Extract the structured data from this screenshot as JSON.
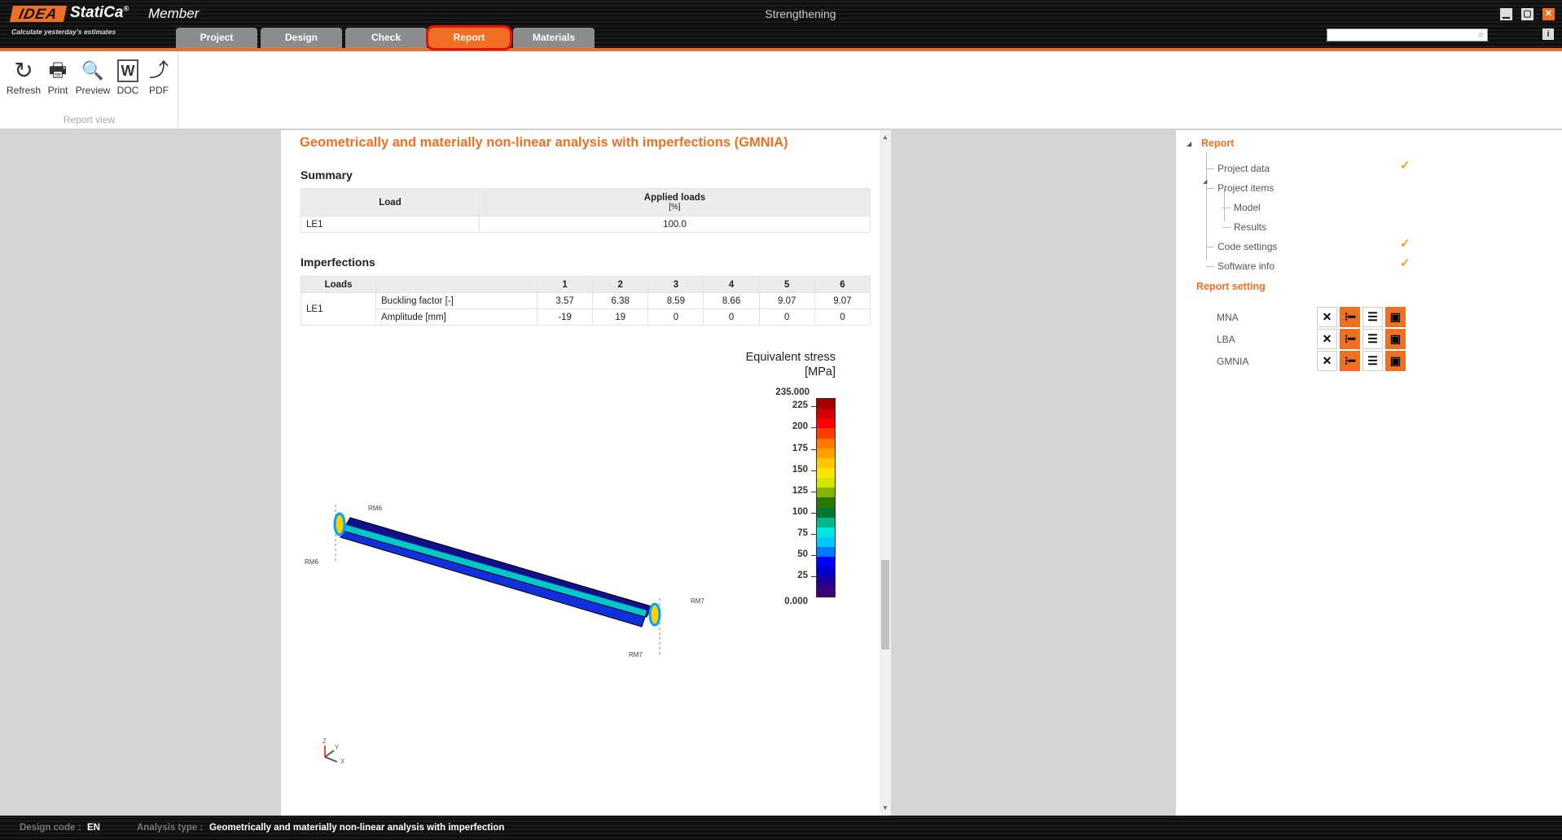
{
  "app": {
    "logo_brand": "IDEA",
    "logo_name": "StatiCa",
    "logo_reg": "®",
    "product": "Member",
    "tagline": "Calculate yesterday's estimates",
    "title": "Strengthening"
  },
  "tabs": [
    {
      "label": "Project"
    },
    {
      "label": "Design"
    },
    {
      "label": "Check"
    },
    {
      "label": "Report",
      "active": true
    },
    {
      "label": "Materials"
    }
  ],
  "search": {
    "placeholder": "",
    "icon": "search-icon"
  },
  "window_controls": {
    "minimize": "▁",
    "maximize": "▢",
    "close": "✕",
    "info": "i"
  },
  "ribbon": {
    "group_label": "Report view",
    "buttons": [
      {
        "label": "Refresh",
        "icon": "refresh-icon",
        "glyph": "↻"
      },
      {
        "label": "Print",
        "icon": "printer-icon",
        "glyph": "🖶"
      },
      {
        "label": "Preview",
        "icon": "preview-icon",
        "glyph": "🔍"
      },
      {
        "label": "DOC",
        "icon": "word-doc-icon",
        "glyph": "W"
      },
      {
        "label": "PDF",
        "icon": "pdf-icon",
        "glyph": "⤴"
      }
    ]
  },
  "report": {
    "title": "Geometrically and materially non-linear analysis with imperfections (GMNIA)",
    "summary": {
      "heading": "Summary",
      "headers": [
        "Load",
        "Applied loads",
        "[%]"
      ],
      "rows": [
        [
          "LE1",
          "100.0"
        ]
      ]
    },
    "imperfections": {
      "heading": "Imperfections",
      "headers": [
        "Loads",
        "",
        "1",
        "2",
        "3",
        "4",
        "5",
        "6"
      ],
      "load": "LE1",
      "rows": [
        {
          "label": "Buckling factor [-]",
          "values": [
            "3.57",
            "6.38",
            "8.59",
            "8.66",
            "9.07",
            "9.07"
          ]
        },
        {
          "label": "Amplitude [mm]",
          "values": [
            "-19",
            "19",
            "0",
            "0",
            "0",
            "0"
          ]
        }
      ]
    },
    "figure": {
      "legend_title": "Equivalent stress",
      "legend_unit": "[MPa]",
      "max_label": "235.000",
      "min_label": "0.000",
      "ticks": [
        "225",
        "200",
        "175",
        "150",
        "125",
        "100",
        "75",
        "50",
        "25"
      ],
      "tick_values": [
        225,
        200,
        175,
        150,
        125,
        100,
        75,
        50,
        25
      ],
      "range": [
        0,
        235
      ],
      "colors": [
        "#a00000",
        "#d00000",
        "#ff0000",
        "#ff3c00",
        "#ff7800",
        "#ffa000",
        "#ffc800",
        "#ffe600",
        "#d2e600",
        "#82b400",
        "#287800",
        "#007832",
        "#00b48c",
        "#00e6dc",
        "#00c8ff",
        "#0078ff",
        "#0000ff",
        "#0000c8",
        "#1e0096",
        "#3c0078"
      ],
      "labels": {
        "rm6_top": "RM6",
        "rm6_left": "RM6",
        "rm7_right": "RM7",
        "rm7_bottom": "RM7"
      },
      "axes": {
        "z": "Z",
        "y": "Y",
        "x": "X"
      }
    }
  },
  "right_panel": {
    "tree_root": "Report",
    "items": [
      {
        "label": "Project data",
        "checked": true
      },
      {
        "label": "Project items",
        "checked": false
      },
      {
        "label": "Model",
        "checked": false
      },
      {
        "label": "Results",
        "checked": false
      },
      {
        "label": "Code settings",
        "checked": true
      },
      {
        "label": "Software info",
        "checked": true
      }
    ],
    "check_glyph": "✓",
    "settings_heading": "Report setting",
    "settings": [
      {
        "label": "MNA"
      },
      {
        "label": "LBA"
      },
      {
        "label": "GMNIA"
      }
    ],
    "setting_buttons": [
      {
        "icon": "none-icon",
        "glyph": "✕"
      },
      {
        "icon": "brief-icon",
        "glyph": "⁝━"
      },
      {
        "icon": "detailed-list-icon",
        "glyph": "☰"
      },
      {
        "icon": "picture-icon",
        "glyph": "▣"
      }
    ]
  },
  "status": {
    "design_code_label": "Design code :",
    "design_code": "EN",
    "analysis_type_label": "Analysis type :",
    "analysis_type": "Geometrically and materially non-linear analysis with imperfection"
  }
}
